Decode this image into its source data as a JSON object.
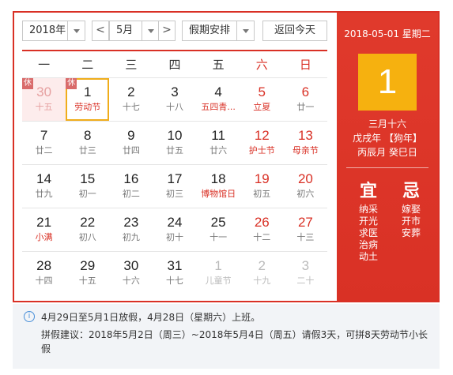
{
  "toolbar": {
    "year": "2018年",
    "prev": "<",
    "month": "5月",
    "next": ">",
    "holiday": "假期安排",
    "today": "返回今天"
  },
  "weekdays": [
    "一",
    "二",
    "三",
    "四",
    "五",
    "六",
    "日"
  ],
  "weeks": [
    [
      {
        "num": "30",
        "sub": "十五",
        "other": true,
        "rest": true,
        "tag": "休"
      },
      {
        "num": "1",
        "sub": "劳动节",
        "rest": false,
        "today": true,
        "tag": "休"
      },
      {
        "num": "2",
        "sub": "十七"
      },
      {
        "num": "3",
        "sub": "十八"
      },
      {
        "num": "4",
        "sub": "五四青...",
        "fest": true
      },
      {
        "num": "5",
        "sub": "立夏",
        "we": true,
        "fest": true
      },
      {
        "num": "6",
        "sub": "廿一",
        "we": true
      }
    ],
    [
      {
        "num": "7",
        "sub": "廿二"
      },
      {
        "num": "8",
        "sub": "廿三"
      },
      {
        "num": "9",
        "sub": "廿四"
      },
      {
        "num": "10",
        "sub": "廿五"
      },
      {
        "num": "11",
        "sub": "廿六"
      },
      {
        "num": "12",
        "sub": "护士节",
        "we": true,
        "fest": true
      },
      {
        "num": "13",
        "sub": "母亲节",
        "we": true,
        "fest": true
      }
    ],
    [
      {
        "num": "14",
        "sub": "廿九"
      },
      {
        "num": "15",
        "sub": "初一"
      },
      {
        "num": "16",
        "sub": "初二"
      },
      {
        "num": "17",
        "sub": "初三"
      },
      {
        "num": "18",
        "sub": "博物馆日",
        "fest": true
      },
      {
        "num": "19",
        "sub": "初五",
        "we": true
      },
      {
        "num": "20",
        "sub": "初六",
        "we": true
      }
    ],
    [
      {
        "num": "21",
        "sub": "小满",
        "fest": true
      },
      {
        "num": "22",
        "sub": "初八"
      },
      {
        "num": "23",
        "sub": "初九"
      },
      {
        "num": "24",
        "sub": "初十"
      },
      {
        "num": "25",
        "sub": "十一"
      },
      {
        "num": "26",
        "sub": "十二",
        "we": true
      },
      {
        "num": "27",
        "sub": "十三",
        "we": true
      }
    ],
    [
      {
        "num": "28",
        "sub": "十四"
      },
      {
        "num": "29",
        "sub": "十五"
      },
      {
        "num": "30",
        "sub": "十六"
      },
      {
        "num": "31",
        "sub": "十七"
      },
      {
        "num": "1",
        "sub": "儿童节",
        "other": true
      },
      {
        "num": "2",
        "sub": "十九",
        "other": true
      },
      {
        "num": "3",
        "sub": "二十",
        "other": true
      }
    ]
  ],
  "detail": {
    "date": "2018-05-01 星期二",
    "big_day": "1",
    "lunar1": "三月十六",
    "lunar2": "戊戌年 【狗年】",
    "lunar3": "丙辰月 癸巳日",
    "yi_title": "宜",
    "yi": [
      "纳采",
      "开光",
      "求医",
      "治病",
      "动土"
    ],
    "ji_title": "忌",
    "ji": [
      "嫁娶",
      "开市",
      "安葬"
    ]
  },
  "info": {
    "icon": "i",
    "line1": "4月29日至5月1日放假，4月28日（星期六）上班。",
    "line2": "拼假建议：2018年5月2日（周三）~2018年5月4日（周五）请假3天，可拼8天劳动节小长假"
  },
  "colors": {
    "accent": "#d93025",
    "today_border": "#f0ad1a",
    "big_day_bg": "#f6b10f"
  }
}
